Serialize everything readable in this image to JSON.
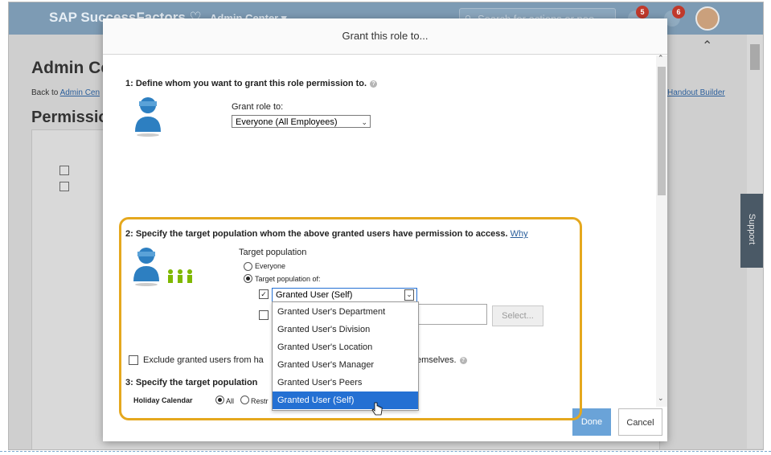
{
  "app": {
    "brand": "SAP SuccessFactors",
    "menu": "Admin Center ▾",
    "search_placeholder": "Search for actions or peo",
    "badges": [
      "5",
      "6"
    ]
  },
  "background_page": {
    "title": "Admin Ce",
    "back_prefix": "Back to ",
    "back_link": "Admin Cen",
    "section_title": "Permissio",
    "handout_link": "Handout Builder",
    "support_tab": "Support"
  },
  "dialog": {
    "title": "Grant this role to...",
    "section1": {
      "heading": "1: Define whom you want to grant this role permission to.",
      "grant_label": "Grant role to:",
      "grant_value": "Everyone (All Employees)"
    },
    "section2": {
      "heading": "2: Specify the target population whom the above granted users have permission to access.",
      "why_link": "Why",
      "target_label": "Target population",
      "radio_everyone": "Everyone",
      "radio_target_of": "Target population of:",
      "target_select_value": "Granted User (Self)",
      "select_button": "Select...",
      "exclude_prefix": "Exclude granted users from ha",
      "exclude_suffix": "emselves."
    },
    "section3": {
      "heading": "3: Specify the target population",
      "row_label": "Holiday Calendar",
      "radio_all": "All",
      "radio_restr": "Restr"
    },
    "dropdown_options": [
      "Granted User's Department",
      "Granted User's Division",
      "Granted User's Location",
      "Granted User's Manager",
      "Granted User's Peers",
      "Granted User (Self)"
    ],
    "buttons": {
      "done": "Done",
      "cancel": "Cancel"
    }
  },
  "colors": {
    "accent": "#2470d3",
    "highlight": "#e5a81e",
    "done_button": "#6aa3d8"
  }
}
